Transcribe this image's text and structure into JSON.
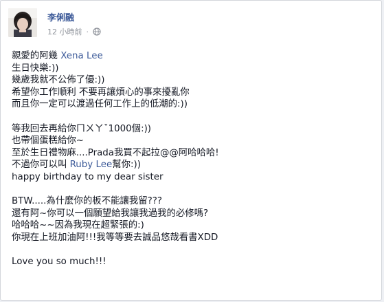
{
  "post": {
    "author": "李俐融",
    "timestamp": "12 小時前",
    "lines": {
      "l1a": "親愛的阿幾 ",
      "l1tag": "Xena Lee",
      "l2": "生日快樂:))",
      "l3": "幾歲我就不公佈了優:))",
      "l4": "希望你工作順利 不要再讓煩心的事來擾亂你",
      "l5": "而且你一定可以渡過任何工作上的低潮的:))",
      "l6": "等我回去再給你ㄇㄨㄚˇ1000個:))",
      "l7": "也帶個蛋糕給你~",
      "l8": "至於生日禮物麻....Prada我買不起拉@@阿哈哈哈!",
      "l9a": "不過你可以叫 ",
      "l9tag": "Ruby Lee",
      "l9b": "幫你:))",
      "l10": "happy birthday to my dear sister",
      "l11": "BTW.....為什麼你的板不能讓我留???",
      "l12": "還有阿~你可以一個願望給我讓我過我的必修嗎?",
      "l13": "哈哈哈~~因為我現在超緊張的:)",
      "l14": "你現在上班加油阿!!!我等等要去誠品悠哉看書XDD",
      "l15": "Love you so much!!!"
    }
  },
  "colors": {
    "link": "#3b5998",
    "meta": "#90949c",
    "text": "#141823"
  },
  "icons": {
    "privacy": "globe-icon"
  }
}
